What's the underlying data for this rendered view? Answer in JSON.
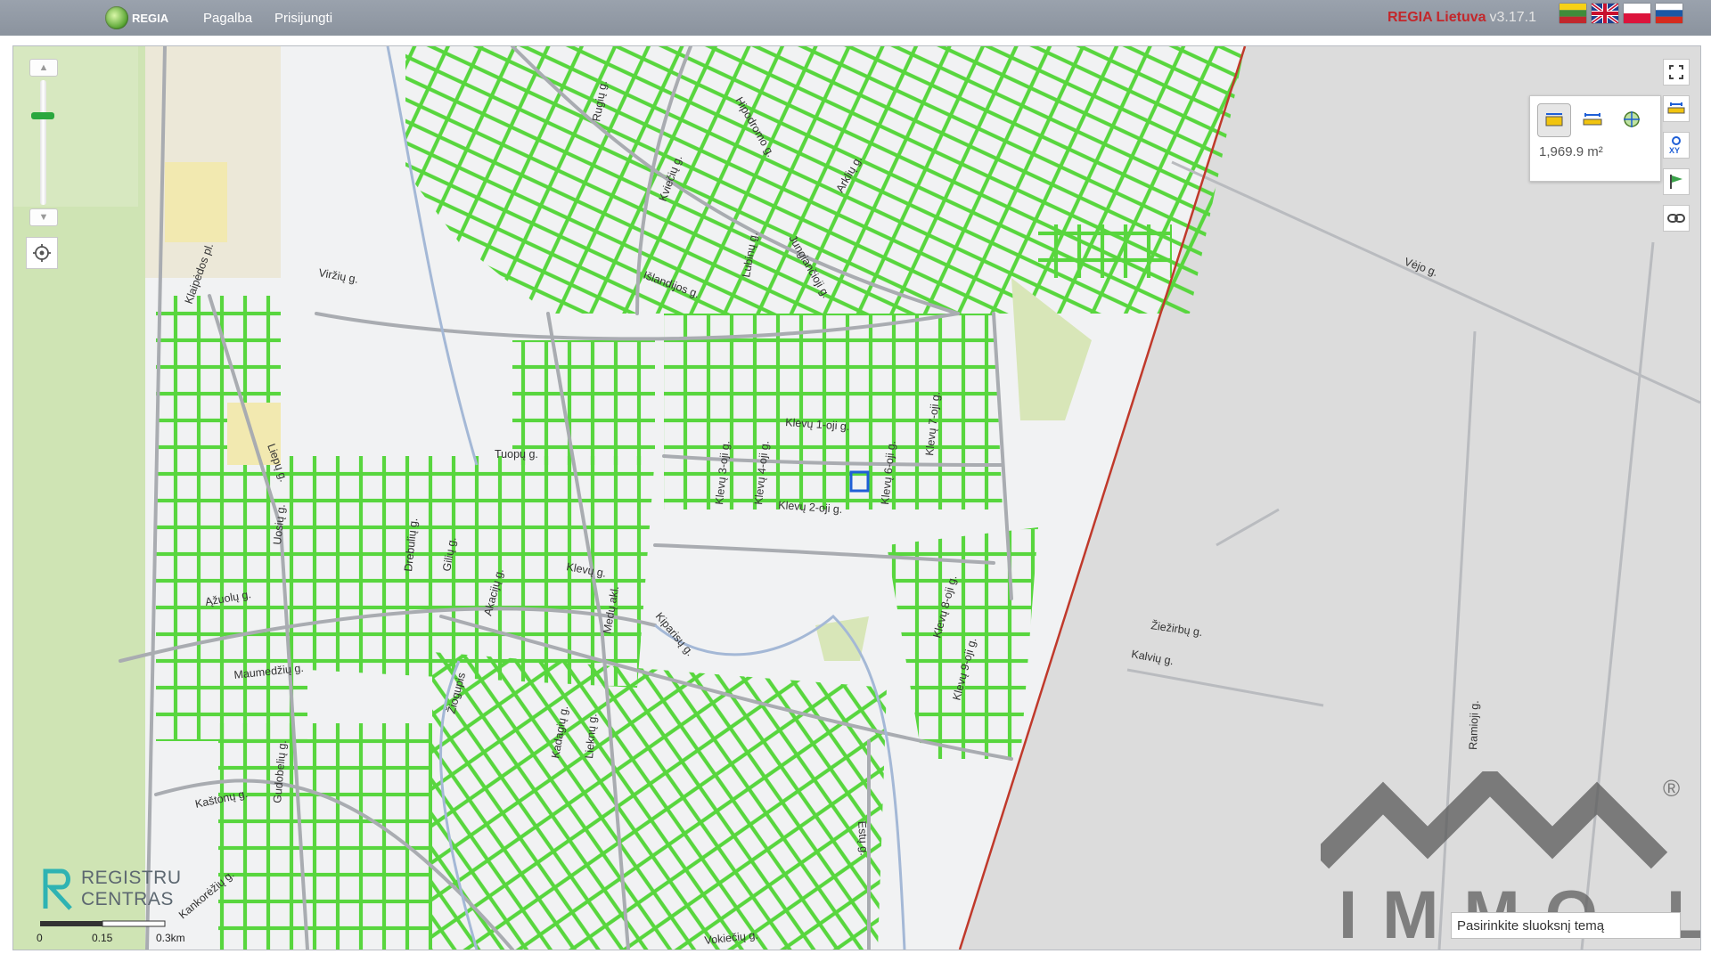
{
  "header": {
    "logo_text": "REGIA",
    "menu": [
      {
        "label": "Pagalba"
      },
      {
        "label": "Prisijungti"
      }
    ],
    "app_name": "REGIA Lietuva",
    "version": "v3.17.1",
    "languages": [
      "lt",
      "en",
      "pl",
      "ru"
    ]
  },
  "map": {
    "measure": {
      "tools": [
        "area-measure-icon",
        "distance-measure-icon",
        "coordinate-measure-icon"
      ],
      "active": "area-measure-icon",
      "value": "1,969.9 m²"
    },
    "right_tools": [
      "fullscreen-icon",
      "measure-icon",
      "xy-coordinates-icon",
      "flag-icon",
      "link-icon"
    ],
    "attribution": [
      "REGISTRU",
      "CENTRAS"
    ],
    "scale_labels": [
      "0",
      "0.15",
      "0.3km"
    ],
    "layer_select_label": "Pasirinkite sluoksnį temą",
    "watermark": "IMMO.LT",
    "watermark_mark": "®",
    "streets": [
      "Klevų 1-oji g.",
      "Klevų 2-oji g.",
      "Klevų 3-oji g.",
      "Klevų 4-oji g.",
      "Klevų 6-oji g.",
      "Klevų 7-oji g.",
      "Klevų 8-oji g.",
      "Klevų 9-oji g.",
      "Klevų g.",
      "Viržių g.",
      "Ąžuolų g.",
      "Kiparisų g.",
      "Tuopų g.",
      "Maumedžių g.",
      "Kaštonų g.",
      "Klaipėdos pl.",
      "Hipodromo g.",
      "Arklių g.",
      "Vėjo g.",
      "Žiežirbų g.",
      "Kalvių g.",
      "Ramioji g.",
      "Estų g.",
      "Liepų g.",
      "Uosių g.",
      "Drebulių g.",
      "Gilių g.",
      "Akacijų g.",
      "Medų akl.",
      "Žiogupis",
      "Lubinų g.",
      "Jungiančioji g.",
      "Kviečių g.",
      "Rugių g.",
      "Išlandijos g.",
      "Kadagių g.",
      "Lieknų g.",
      "Vokiečių g.",
      "Kankorėžių g.",
      "Gudobelių g."
    ]
  }
}
